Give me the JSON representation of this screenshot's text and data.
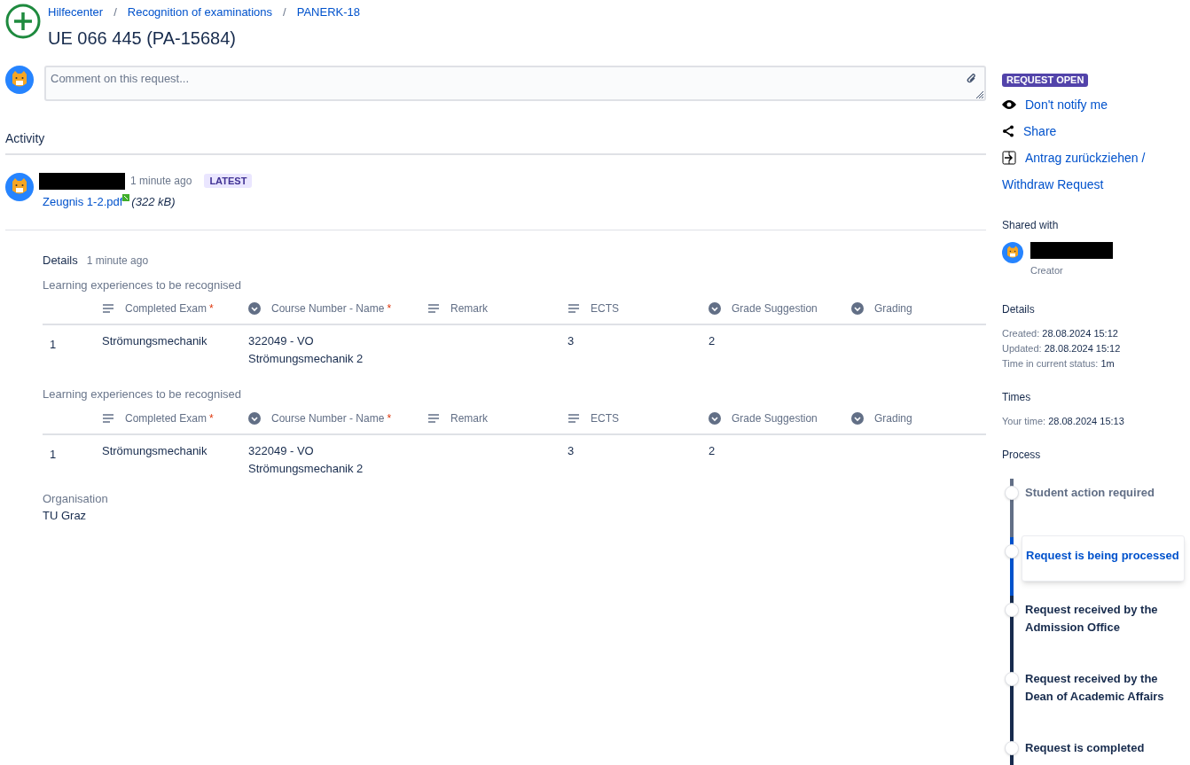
{
  "breadcrumbs": [
    {
      "label": "Hilfecenter"
    },
    {
      "separator": "/",
      "label": "Recognition of examinations"
    },
    {
      "separator": "/",
      "label": "PANERK-18"
    }
  ],
  "title": "UE 066 445 (PA-15684)",
  "comment": {
    "placeholder": "Comment on this request..."
  },
  "activity": {
    "heading": "Activity",
    "time": "1 minute ago",
    "badge": "LATEST",
    "attachment": {
      "name": "Zeugnis 1-2.pdf",
      "size": "(322 kB)"
    }
  },
  "details": {
    "heading": "Details",
    "time": "1 minute ago",
    "tables": [
      {
        "caption": "Learning experiences to be recognised",
        "columns": [
          {
            "label": "Completed Exam",
            "kind": "text",
            "required_mark": "*"
          },
          {
            "label": "Course Number - Name",
            "kind": "select",
            "required_mark": "*"
          },
          {
            "label": "Remark",
            "kind": "text"
          },
          {
            "label": "ECTS",
            "kind": "text"
          },
          {
            "label": "Grade Suggestion",
            "kind": "select"
          },
          {
            "label": "Grading",
            "kind": "select"
          }
        ],
        "rows": [
          {
            "index": "1",
            "cells": [
              "Strömungsmechanik",
              "322049 - VO\nStrömungsmechanik 2",
              "",
              "3",
              "2",
              ""
            ]
          }
        ]
      },
      {
        "caption": "Learning experiences to be recognised",
        "columns": [
          {
            "label": "Completed Exam",
            "kind": "text",
            "required_mark": "*"
          },
          {
            "label": "Course Number - Name",
            "kind": "select",
            "required_mark": "*"
          },
          {
            "label": "Remark",
            "kind": "text"
          },
          {
            "label": "ECTS",
            "kind": "text"
          },
          {
            "label": "Grade Suggestion",
            "kind": "select"
          },
          {
            "label": "Grading",
            "kind": "select"
          }
        ],
        "rows": [
          {
            "index": "1",
            "cells": [
              "Strömungsmechanik",
              "322049 - VO\nStrömungsmechanik 2",
              "",
              "3",
              "2",
              ""
            ]
          }
        ]
      }
    ],
    "organisation": {
      "label": "Organisation",
      "value": "TU Graz"
    }
  },
  "sidebar": {
    "status": "REQUEST OPEN",
    "actions": [
      {
        "kind": "eye",
        "label": "Don't notify me"
      },
      {
        "kind": "share",
        "label": "Share"
      },
      {
        "kind": "withdraw",
        "label": "Antrag zurückziehen /"
      },
      {
        "kind": "none",
        "label": "Withdraw Request"
      }
    ],
    "shared_heading": "Shared with",
    "shared_role": "Creator",
    "details_heading": "Details",
    "details": [
      {
        "label": "Created:",
        "value": "28.08.2024 15:12"
      },
      {
        "label": "Updated:",
        "value": "28.08.2024 15:12"
      },
      {
        "label": "Time in current status:",
        "value": "1m"
      }
    ],
    "times_heading": "Times",
    "times": [
      {
        "label": "Your time:",
        "value": "28.08.2024 15:13"
      }
    ],
    "process_heading": "Process",
    "process": [
      {
        "label": "Student action required",
        "kind": "past"
      },
      {
        "label": "Request is being processed",
        "kind": "current"
      },
      {
        "label": "Request received by the Admission Office",
        "kind": "future"
      },
      {
        "label": "Request received by the Dean of Academic Affairs",
        "kind": "future"
      },
      {
        "label": "Request is completed",
        "kind": "future"
      }
    ]
  }
}
